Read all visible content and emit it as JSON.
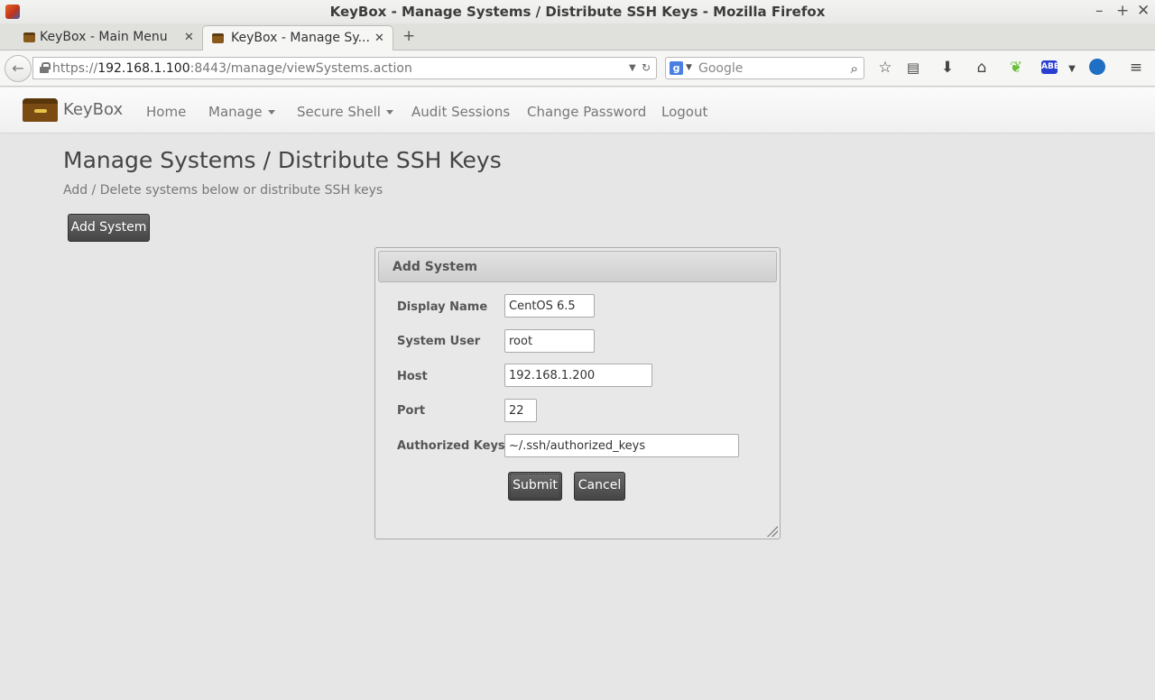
{
  "window": {
    "title": "KeyBox - Manage Systems / Distribute SSH Keys - Mozilla Firefox"
  },
  "tabs": [
    {
      "label": "KeyBox - Main Menu",
      "active": false
    },
    {
      "label": "KeyBox - Manage Sy...",
      "active": true
    }
  ],
  "urlbar": {
    "scheme": "https://",
    "host": "192.168.1.100",
    "rest": ":8443/manage/viewSystems.action"
  },
  "search": {
    "placeholder": "Google"
  },
  "app": {
    "brand": "KeyBox",
    "nav": {
      "home": "Home",
      "manage": "Manage",
      "secure_shell": "Secure Shell",
      "audit_sessions": "Audit Sessions",
      "change_password": "Change Password",
      "logout": "Logout"
    }
  },
  "page": {
    "title": "Manage Systems / Distribute SSH Keys",
    "subtitle": "Add / Delete systems below or distribute SSH keys",
    "add_button": "Add System"
  },
  "dialog": {
    "title": "Add System",
    "fields": {
      "display_name": {
        "label": "Display Name",
        "value": "CentOS 6.5"
      },
      "system_user": {
        "label": "System User",
        "value": "root"
      },
      "host": {
        "label": "Host",
        "value": "192.168.1.200"
      },
      "port": {
        "label": "Port",
        "value": "22"
      },
      "authorized_keys": {
        "label": "Authorized Keys",
        "value": "~/.ssh/authorized_keys"
      }
    },
    "submit": "Submit",
    "cancel": "Cancel"
  },
  "icons": {
    "window_controls": [
      "minimize-icon",
      "maximize-icon",
      "close-icon"
    ],
    "toolbar": [
      "bookmark-star-icon",
      "reading-list-icon",
      "downloads-icon",
      "home-icon",
      "leaf-addon-icon",
      "abe-noscript-icon",
      "addon-menu-icon",
      "globe-addon-icon",
      "hamburger-menu-icon"
    ]
  },
  "colors": {
    "button_dark": "#4f4f4f",
    "page_background": "#e6e6e6"
  }
}
